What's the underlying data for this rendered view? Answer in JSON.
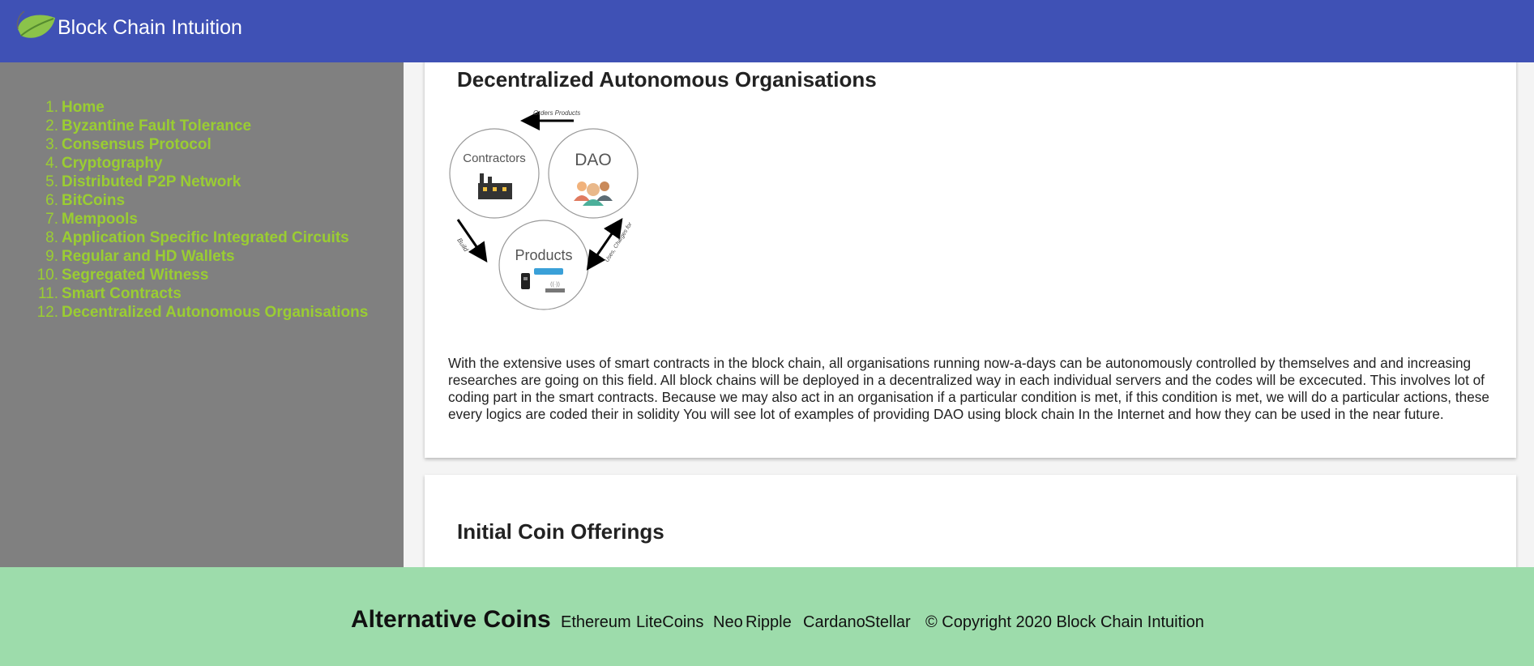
{
  "header": {
    "title": "Block Chain Intuition",
    "logo_icon": "leaf-icon",
    "background": "#3f51b5"
  },
  "sidebar": {
    "background": "#808080",
    "link_color": "#9acd32",
    "items": [
      {
        "num": "1.",
        "label": "Home"
      },
      {
        "num": "2.",
        "label": "Byzantine Fault Tolerance"
      },
      {
        "num": "3.",
        "label": "Consensus Protocol"
      },
      {
        "num": "4.",
        "label": "Cryptography"
      },
      {
        "num": "5.",
        "label": "Distributed P2P Network"
      },
      {
        "num": "6.",
        "label": "BitCoins"
      },
      {
        "num": "7.",
        "label": "Mempools"
      },
      {
        "num": "8.",
        "label": "Application Specific Integrated Circuits"
      },
      {
        "num": "9.",
        "label": "Regular and HD Wallets"
      },
      {
        "num": "10.",
        "label": "Segregated Witness"
      },
      {
        "num": "11.",
        "label": "Smart Contracts"
      },
      {
        "num": "12.",
        "label": "Decentralized Autonomous Organisations"
      }
    ]
  },
  "main": {
    "sections": [
      {
        "heading": "Decentralized Autonomous Organisations",
        "diagram": {
          "orders_label": "Orders Products",
          "contractors_label": "Contractors",
          "dao_label": "DAO",
          "products_label": "Products",
          "build_label": "Build",
          "uses_label": "Uses, Charges for"
        },
        "paragraph": "With the extensive uses of smart contracts in the block chain, all organisations running now-a-days can be autonomously controlled by themselves and and increasing researches are going on this field. All block chains will be deployed in a decentralized way in each individual servers and the codes will be excecuted. This involves lot of coding part in the smart contracts. Because we may also act in an organisation if a particular condition is met, if this condition is met, we will do a particular actions, these every logics are coded their in solidity You will see lot of examples of providing DAO using block chain In the Internet and how they can be used in the near future."
      },
      {
        "heading": "Initial Coin Offerings"
      }
    ]
  },
  "footer": {
    "background": "#9ddcab",
    "title": "Alternative Coins",
    "links": [
      "Ethereum",
      "LiteCoins",
      "Neo",
      "Ripple",
      "Cardano",
      "Stellar"
    ],
    "copyright": "© Copyright 2020 Block Chain Intuition"
  }
}
